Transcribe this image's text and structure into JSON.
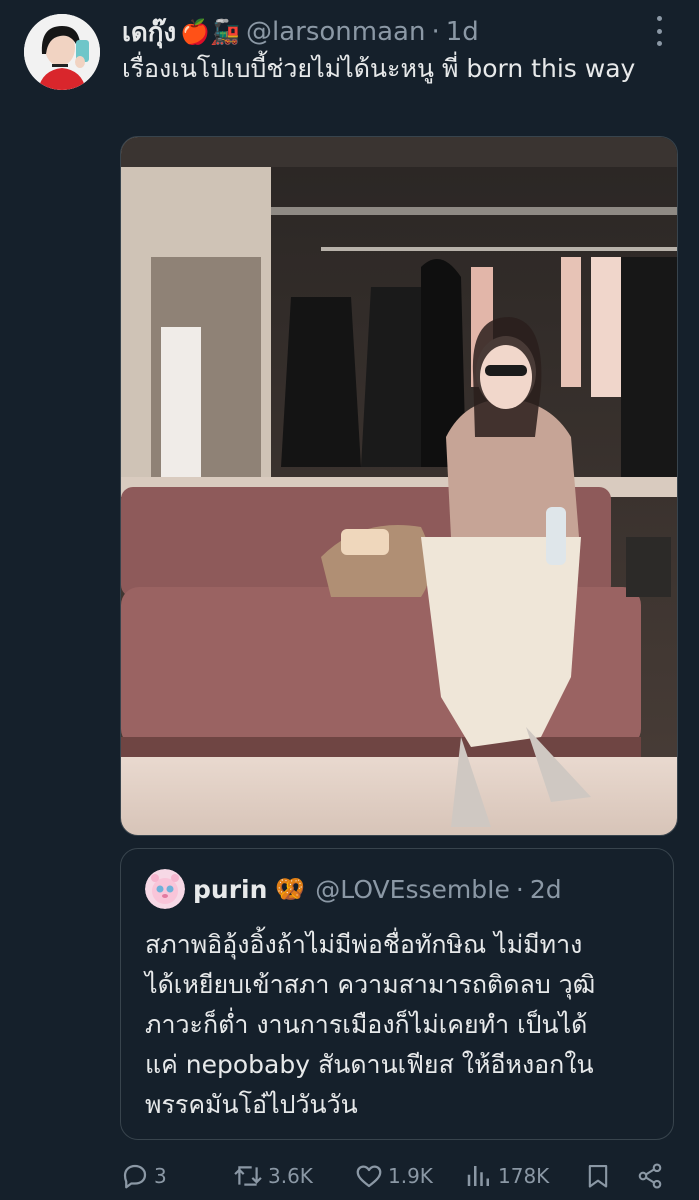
{
  "tweet": {
    "display_name": "เดกุ๊ง",
    "badges": "🍎🚂",
    "handle": "@larsonmaan",
    "separator": "·",
    "time": "1d",
    "text": "เรื่องเนโปเบบี้ช่วยไม่ได้นะหนู พี่ born this way"
  },
  "quote": {
    "display_name": "purin",
    "badge": "🥨",
    "handle": "@LOVEssembIe",
    "separator": "·",
    "time": "2d",
    "text_lines": [
      "สภาพอิอุ้งอิ้งถ้าไม่มีพ่อชื่อทักษิณ ไม่มีทาง",
      "ได้เหยียบเข้าสภา ความสามารถติดลบ วุฒิ",
      "ภาวะก็ต่ำ งานการเมืองก็ไม่เคยทำ เป็นได้",
      "แค่ nepobaby สันดานเฟียส ให้อีหงอกใน",
      "พรรคมันโอ๋ไปวันวัน"
    ]
  },
  "actions": {
    "replies": "3",
    "retweets": "3.6K",
    "likes": "1.9K",
    "views": "178K"
  },
  "icons": {
    "more": "more-vertical-icon",
    "reply": "reply-icon",
    "retweet": "retweet-icon",
    "like": "heart-icon",
    "views": "views-icon",
    "bookmark": "bookmark-icon",
    "share": "share-icon"
  },
  "colors": {
    "background": "#15202b",
    "text": "#e7e9ea",
    "secondary_text": "#8b98a5",
    "border": "#38444d"
  }
}
